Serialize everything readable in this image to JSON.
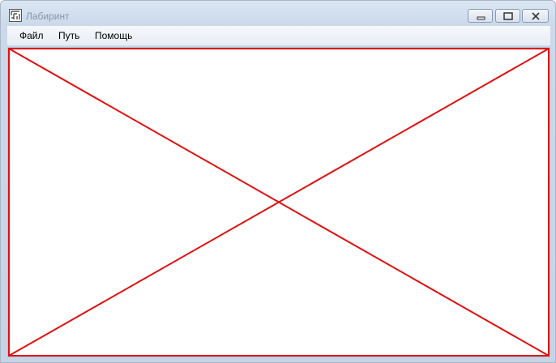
{
  "window": {
    "title": "Лабиринт",
    "icon": "maze-app-icon"
  },
  "caption_buttons": {
    "minimize_icon": "minimize-icon",
    "maximize_icon": "maximize-icon",
    "close_icon": "close-icon"
  },
  "menu": {
    "items": [
      {
        "label": "Файл"
      },
      {
        "label": "Путь"
      },
      {
        "label": "Помощь"
      }
    ]
  },
  "canvas": {
    "placeholder_shape": "red-x",
    "stroke_color": "#e01010",
    "background": "#ffffff"
  }
}
